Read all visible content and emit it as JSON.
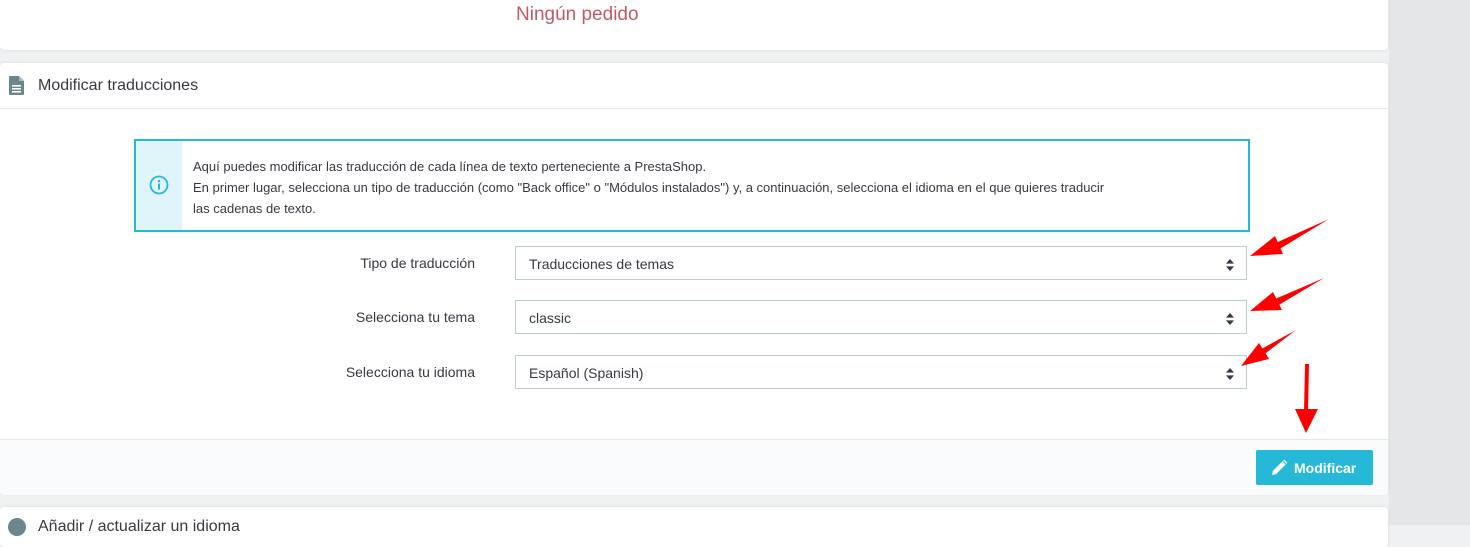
{
  "top_panel": {
    "empty_text": "Ningún pedido"
  },
  "translations_panel": {
    "title": "Modificar traducciones",
    "info_lines": [
      "Aquí puedes modificar las traducción de cada línea de texto perteneciente a PrestaShop.",
      "En primer lugar, selecciona un tipo de traducción (como \"Back office\" o \"Módulos instalados\") y, a continuación, selecciona el idioma en el que quieres traducir",
      "las cadenas de texto."
    ],
    "fields": [
      {
        "label": "Tipo de traducción",
        "value": "Traducciones de temas"
      },
      {
        "label": "Selecciona tu tema",
        "value": "classic"
      },
      {
        "label": "Selecciona tu idioma",
        "value": "Español (Spanish)"
      }
    ],
    "submit_label": "Modificar"
  },
  "next_panel": {
    "title": "Añadir / actualizar un idioma"
  },
  "icons": {
    "panel": "document-icon",
    "info": "info-circle-icon",
    "select": "sort-caret-icon",
    "button": "pencil-icon"
  },
  "colors": {
    "accent": "#25b9d7",
    "info_bg": "#dff5f9",
    "empty_text": "#c05c67",
    "annotation_arrow": "#ff0000"
  }
}
